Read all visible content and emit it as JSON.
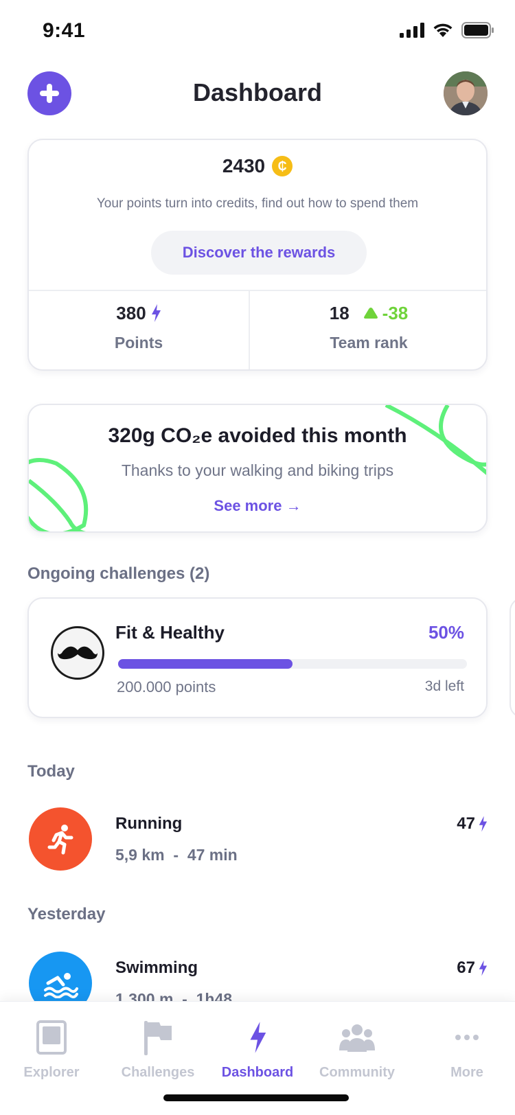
{
  "status_bar": {
    "time": "9:41"
  },
  "header": {
    "title": "Dashboard"
  },
  "points_card": {
    "credits": "2430",
    "coin_symbol": "₵",
    "description": "Your points turn into credits, find out how to spend them",
    "rewards_button": "Discover the rewards",
    "points_value": "380",
    "points_label": "Points",
    "rank_value": "18",
    "rank_change": "-38",
    "rank_label": "Team rank"
  },
  "co2_card": {
    "title": "320g CO₂e avoided this month",
    "subtitle": "Thanks to your walking and biking trips",
    "link": "See more →"
  },
  "challenges": {
    "section_title": "Ongoing challenges (2)",
    "items": [
      {
        "name": "Fit & Healthy",
        "percent": "50%",
        "progress": 0.5,
        "target": "200.000 points",
        "time_left": "3d left",
        "icon": "mustache-icon"
      }
    ]
  },
  "today": {
    "section_title": "Today",
    "activities": [
      {
        "name": "Running",
        "meta": "5,9 km  -  47 min",
        "points": "47",
        "icon": "running-icon",
        "color": "#f4532e"
      }
    ]
  },
  "yesterday": {
    "section_title": "Yesterday",
    "activities": [
      {
        "name": "Swimming",
        "meta": "1 300 m  -  1h48",
        "points": "67",
        "icon": "swimming-icon",
        "color": "#1797f2"
      }
    ]
  },
  "tab_bar": {
    "tabs": [
      {
        "label": "Explorer",
        "icon": "explorer-icon",
        "active": false
      },
      {
        "label": "Challenges",
        "icon": "flag-icon",
        "active": false
      },
      {
        "label": "Dashboard",
        "icon": "bolt-icon",
        "active": true
      },
      {
        "label": "Community",
        "icon": "community-icon",
        "active": false
      },
      {
        "label": "More",
        "icon": "more-icon",
        "active": false
      }
    ]
  },
  "colors": {
    "accent": "#6c52e3",
    "positive": "#6fd33a",
    "coin": "#f6bd16",
    "eco_line": "#5ef07a"
  }
}
